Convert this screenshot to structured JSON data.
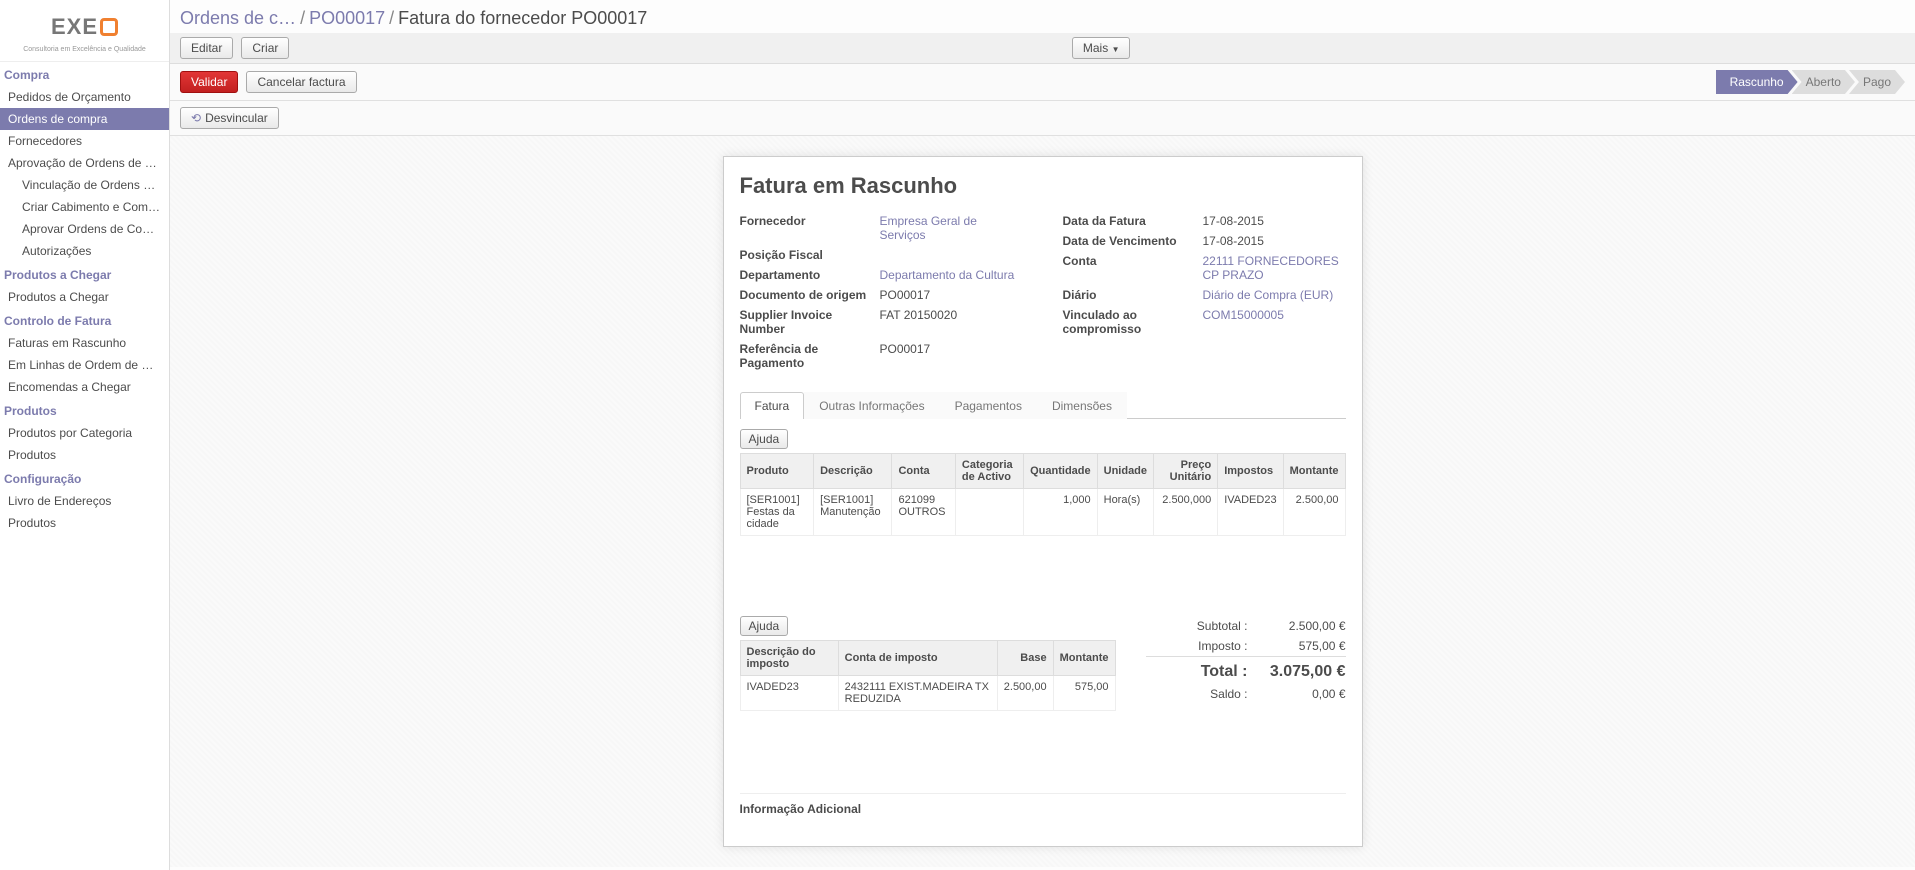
{
  "logo": {
    "text": "EXE",
    "sub": "Consultoria em Excelência e Qualidade"
  },
  "sidebar": {
    "sections": [
      {
        "title": "Compra",
        "items": [
          {
            "label": "Pedidos de Orçamento",
            "sub": false
          },
          {
            "label": "Ordens de compra",
            "sub": false,
            "active": true
          },
          {
            "label": "Fornecedores",
            "sub": false
          },
          {
            "label": "Aprovação de Ordens de Co…",
            "sub": false,
            "expandable": true
          },
          {
            "label": "Vinculação de Ordens de…",
            "sub": true
          },
          {
            "label": "Criar Cabimento e Compr…",
            "sub": true
          },
          {
            "label": "Aprovar Ordens de Compra",
            "sub": true
          },
          {
            "label": "Autorizações",
            "sub": true
          }
        ]
      },
      {
        "title": "Produtos a Chegar",
        "items": [
          {
            "label": "Produtos a Chegar",
            "sub": false
          }
        ]
      },
      {
        "title": "Controlo de Fatura",
        "items": [
          {
            "label": "Faturas em Rascunho",
            "sub": false
          },
          {
            "label": "Em Linhas de Ordem de Co…",
            "sub": false
          },
          {
            "label": "Encomendas a Chegar",
            "sub": false
          }
        ]
      },
      {
        "title": "Produtos",
        "items": [
          {
            "label": "Produtos por Categoria",
            "sub": false
          },
          {
            "label": "Produtos",
            "sub": false
          }
        ]
      },
      {
        "title": "Configuração",
        "items": [
          {
            "label": "Livro de Endereços",
            "sub": false,
            "expandable": true
          },
          {
            "label": "Produtos",
            "sub": false,
            "expandable": true
          }
        ]
      }
    ]
  },
  "breadcrumb": {
    "a": "Ordens de c…",
    "b": "PO00017",
    "current": "Fatura do fornecedor PO00017"
  },
  "toolbar": {
    "edit": "Editar",
    "create": "Criar",
    "more": "Mais"
  },
  "actions": {
    "validate": "Validar",
    "cancel": "Cancelar factura",
    "unlink": "Desvincular"
  },
  "status": {
    "draft": "Rascunho",
    "open": "Aberto",
    "paid": "Pago"
  },
  "form": {
    "title": "Fatura em Rascunho",
    "left": [
      {
        "label": "Fornecedor",
        "value": "Empresa Geral de Serviços",
        "link": true
      },
      {
        "label": "Posição Fiscal",
        "value": ""
      },
      {
        "label": "Departamento",
        "value": "Departamento da Cultura",
        "link": true
      },
      {
        "label": "Documento de origem",
        "value": "PO00017"
      },
      {
        "label": "Supplier Invoice Number",
        "value": "FAT 20150020"
      },
      {
        "label": "Referência de Pagamento",
        "value": "PO00017"
      }
    ],
    "right": [
      {
        "label": "Data da Fatura",
        "value": "17-08-2015"
      },
      {
        "label": "Data de Vencimento",
        "value": "17-08-2015"
      },
      {
        "label": "Conta",
        "value": "22111 FORNECEDORES CP PRAZO",
        "link": true
      },
      {
        "label": "Diário",
        "value": "Diário de Compra (EUR)",
        "link": true
      },
      {
        "label": "Vinculado ao compromisso",
        "value": "COM15000005",
        "link": true
      }
    ]
  },
  "tabs": {
    "t1": "Fatura",
    "t2": "Outras Informações",
    "t3": "Pagamentos",
    "t4": "Dimensões"
  },
  "help_btn": "Ajuda",
  "lines": {
    "headers": [
      "Produto",
      "Descrição",
      "Conta",
      "Categoria de Activo",
      "Quantidade",
      "Unidade",
      "Preço Unitário",
      "Impostos",
      "Montante"
    ],
    "rows": [
      {
        "produto": "[SER1001] Festas da cidade",
        "desc": "[SER1001] Manutenção",
        "conta": "621099 OUTROS",
        "cat": "",
        "qty": "1,000",
        "unit": "Hora(s)",
        "price": "2.500,000",
        "tax": "IVADED23",
        "amount": "2.500,00"
      }
    ]
  },
  "taxes": {
    "headers": [
      "Descrição do imposto",
      "Conta de imposto",
      "Base",
      "Montante"
    ],
    "rows": [
      {
        "desc": "IVADED23",
        "conta": "2432111 EXIST.MADEIRA TX REDUZIDA",
        "base": "2.500,00",
        "amount": "575,00"
      }
    ]
  },
  "totals": {
    "subtotal_l": "Subtotal :",
    "subtotal_v": "2.500,00 €",
    "tax_l": "Imposto :",
    "tax_v": "575,00 €",
    "total_l": "Total :",
    "total_v": "3.075,00 €",
    "balance_l": "Saldo :",
    "balance_v": "0,00 €"
  },
  "extra_head": "Informação Adicional"
}
